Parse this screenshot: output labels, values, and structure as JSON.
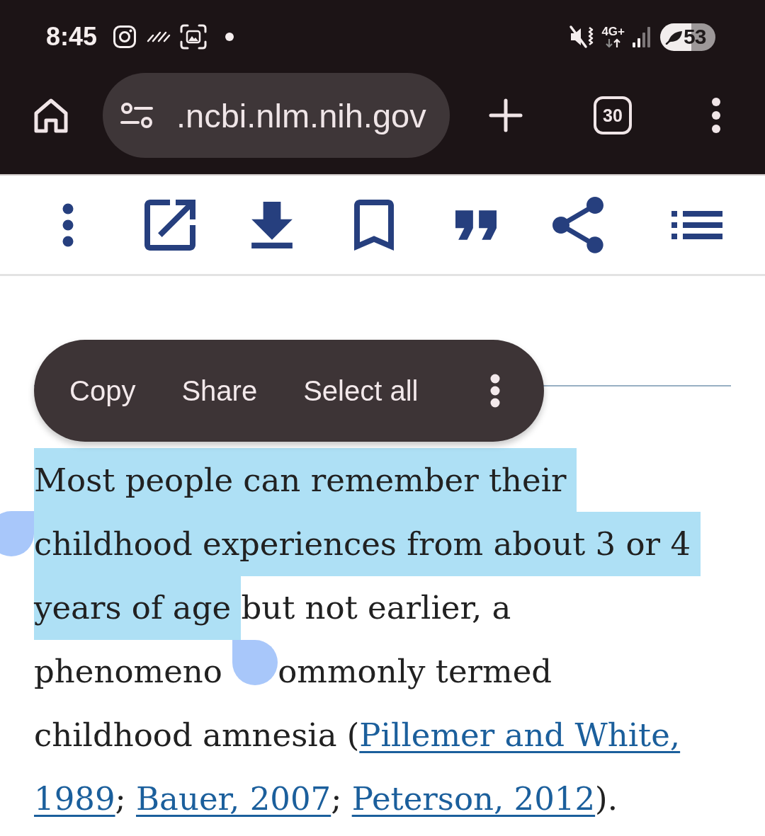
{
  "status_bar": {
    "time": "8:45",
    "network": "4G+",
    "battery": "53"
  },
  "browser_bar": {
    "url": ".ncbi.nlm.nih.gov",
    "tab_count": "30"
  },
  "selection_menu": {
    "items": [
      "Copy",
      "Share",
      "Select all"
    ]
  },
  "article": {
    "lines": [
      [
        {
          "kind": "selected_text",
          "text": "Most people can remember their "
        }
      ],
      [
        {
          "kind": "selected_text",
          "text": "childhood experiences from about 3 or 4 "
        }
      ],
      [
        {
          "kind": "selected_text",
          "text": "years of age "
        },
        {
          "kind": "text",
          "text": "but not earlier, a"
        }
      ],
      [
        {
          "kind": "text",
          "text": "phenomeno "
        },
        {
          "kind": "selection_end_handle"
        },
        {
          "kind": "text",
          "text": "ommonly termed"
        }
      ],
      [
        {
          "kind": "text",
          "text": "childhood amnesia ("
        },
        {
          "kind": "link",
          "text": "Pillemer and White,"
        }
      ],
      [
        {
          "kind": "link",
          "text": "1989"
        },
        {
          "kind": "text",
          "text": "; "
        },
        {
          "kind": "link",
          "text": "Bauer, 2007"
        },
        {
          "kind": "text",
          "text": "; "
        },
        {
          "kind": "link",
          "text": "Peterson, 2012"
        },
        {
          "kind": "text",
          "text": ")."
        }
      ]
    ]
  }
}
